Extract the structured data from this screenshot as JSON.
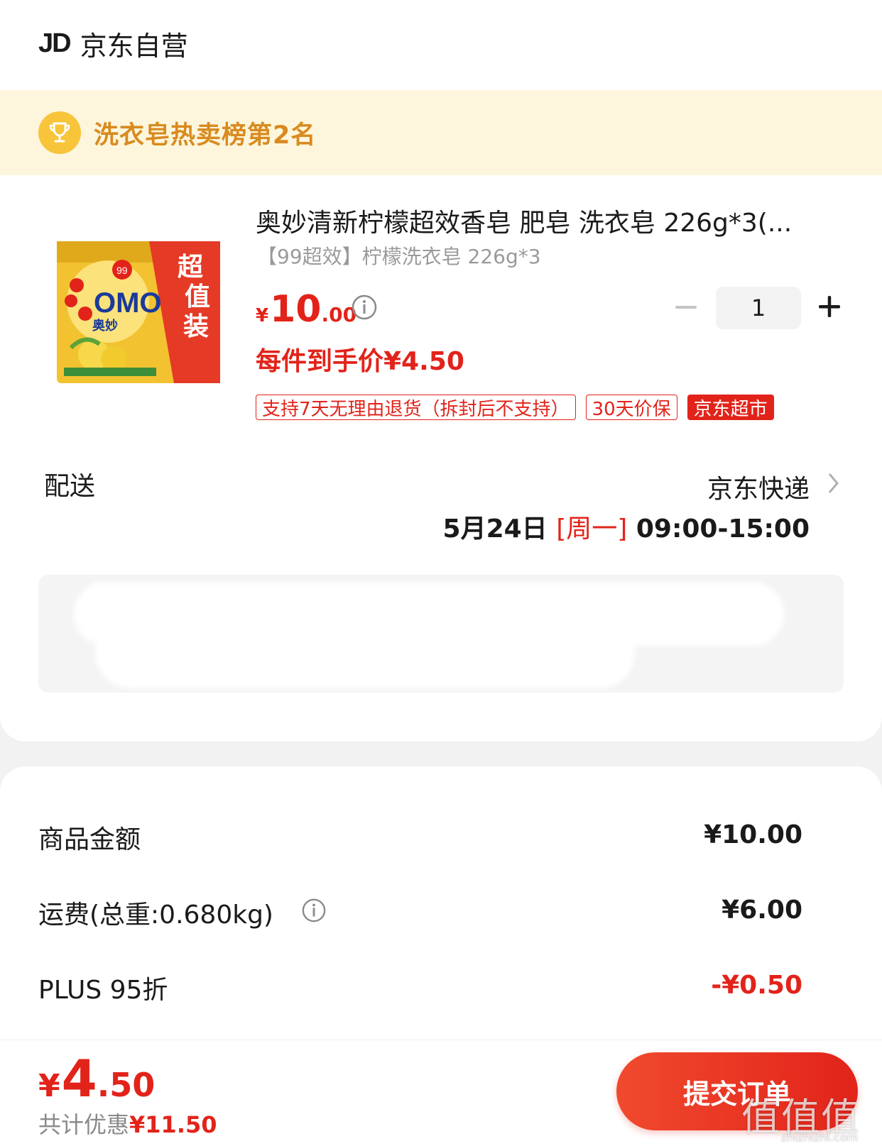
{
  "store": {
    "logo": "JD",
    "name": "京东自营"
  },
  "rank_banner": {
    "text": "洗衣皂热卖榜第2名",
    "icon": "trophy-icon"
  },
  "product": {
    "title": "奥妙清新柠檬超效香皂 肥皂 洗衣皂 226g*3(...",
    "spec": "【99超效】柠檬洗衣皂 226g*3",
    "price_symbol": "¥",
    "price_int": "10",
    "price_dec": ".00",
    "quantity": "1",
    "unit_price": "每件到手价¥4.50",
    "tags": [
      "支持7天无理由退货（拆封后不支持）",
      "30天价保",
      "京东超市"
    ],
    "image_text": {
      "brand": "OMO",
      "cn_brand": "奥妙",
      "badge": "超值装",
      "badge_num": "99"
    }
  },
  "delivery": {
    "label": "配送",
    "method": "京东快递",
    "date": "5月24日",
    "weekday": "[周一]",
    "time": "09:00-15:00"
  },
  "summary": {
    "rows": [
      {
        "label": "商品金额",
        "value": "¥10.00"
      },
      {
        "label": "运费(总重:0.680kg)",
        "value": "¥6.00"
      },
      {
        "label": "PLUS 95折",
        "value": "-¥0.50"
      }
    ]
  },
  "footer": {
    "total_symbol": "¥",
    "total_int": "4",
    "total_dec": ".50",
    "savings_label": "共计优惠",
    "savings_amount": "¥11.50",
    "submit_label": "提交订单"
  },
  "watermark": {
    "main": "值值值",
    "sub": "zhizhizhi.com"
  },
  "colors": {
    "accent": "#e2231a",
    "banner_bg": "#fdf6dc",
    "banner_text": "#d98a1f"
  }
}
